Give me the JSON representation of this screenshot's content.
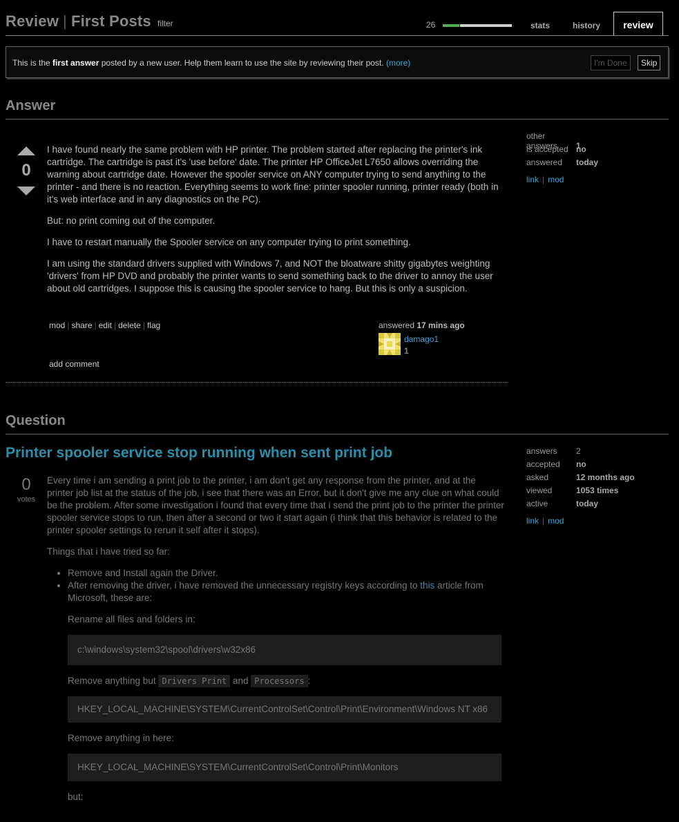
{
  "header": {
    "title_review": "Review",
    "title_section": "First Posts",
    "filter_label": "filter",
    "count": "26",
    "progress": 0.25,
    "tabs": {
      "stats": "stats",
      "history": "history",
      "review": "review"
    }
  },
  "notice": {
    "text_before": "This is the ",
    "bold": "first answer",
    "text_after": " posted by a new user. Help them learn to use the site by reviewing their post. ",
    "more": "(more)",
    "done_button": "I'm Done",
    "skip_button": "Skip"
  },
  "answer": {
    "heading": "Answer",
    "votes": "0",
    "paragraphs": [
      "I have found nearly the same problem with HP printer. The problem started after replacing the printer's ink cartridge. The cartridge is past it's 'use before' date. The printer HP OfficeJet L7650 allows overriding the warning about cartridge date. However the spooler service on ANY computer trying to send anything to the printer - and there is no reaction. Everything seems to work fine: printer spooler running, printer ready (both in it's web interface and in any diagnostics on the PC).",
      "But: no print coming out of the computer.",
      "I have to restart manually the Spooler service on any computer trying to print something.",
      "I am using the standard drivers supplied with Windows 7, and NOT the bloatware shitty gigabytes weighting 'drivers' from HP DVD and probably the printer wants to send something back to the driver to annoy the user about old cartridges. I suppose this is causing the spooler service to hang. But this is only a suspicion."
    ],
    "menu": {
      "mod": "mod",
      "share": "share",
      "edit": "edit",
      "delete": "delete",
      "flag": "flag"
    },
    "add_comment": "add comment",
    "answered_label": "answered",
    "answered_time": "17 mins ago",
    "user_name": "damago1",
    "user_rep": "1",
    "side": {
      "rows": [
        {
          "k": "other answers",
          "v": "1"
        },
        {
          "k": "is accepted",
          "v": "no"
        },
        {
          "k": "answered",
          "v": "today"
        }
      ],
      "link": "link",
      "mod": "mod"
    }
  },
  "question": {
    "heading": "Question",
    "title": "Printer spooler service stop running when sent print job",
    "votes": "0",
    "votes_label": "votes",
    "p1": "Every time i am sending a print job to the printer, i am don't get any response from the printer, and at the printer job list at the status of the job, i see that there was an Error, but it don't give me any clue on what could be the problem. After some investigation i found that every time that i send the print job to the printer the printer spooler service stops to run, then after a second or two it start again (i think that this behavior is related to the printer spooler settings to rerun it self after it stops).",
    "p2": "Things that i have tried so far:",
    "li1": "Remove and Install again the Driver.",
    "li2_before": "After removing the driver, i have removed the unnecessary registry keys according to ",
    "li2_link": "this",
    "li2_after": " article from Microsoft, these are:",
    "rename_label": "Rename all files and folders in:",
    "code1": "c:\\windows\\system32\\spool\\drivers\\w32x86",
    "remove_but_before": "Remove anything but ",
    "inline1": "Drivers Print",
    "remove_but_and": " and ",
    "inline2": "Processors",
    "remove_but_after": ":",
    "code2": "HKEY_LOCAL_MACHINE\\SYSTEM\\CurrentControlSet\\Control\\Print\\Environment\\Windows NT x86",
    "remove_here": "Remove anything in here:",
    "code3": "HKEY_LOCAL_MACHINE\\SYSTEM\\CurrentControlSet\\Control\\Print\\Monitors",
    "but": "but:",
    "side": {
      "rows": [
        {
          "k": "answers",
          "v": "2"
        },
        {
          "k": "accepted",
          "v": "no"
        },
        {
          "k": "asked",
          "v": "12 months ago"
        },
        {
          "k": "viewed",
          "v": "1053 times"
        },
        {
          "k": "active",
          "v": "today"
        }
      ],
      "link": "link",
      "mod": "mod"
    }
  }
}
